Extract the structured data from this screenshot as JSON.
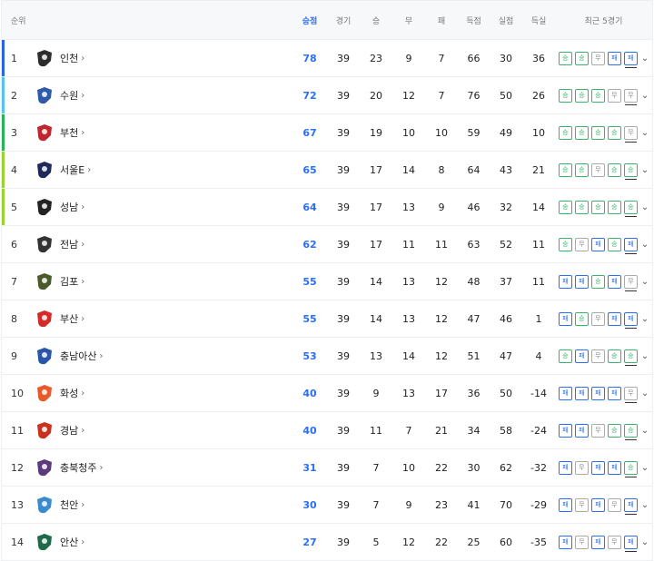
{
  "header": {
    "rank": "순위",
    "points": "승점",
    "played": "경기",
    "won": "승",
    "drawn": "무",
    "lost": "패",
    "gf": "득점",
    "ga": "실점",
    "gd": "득실",
    "form": "최근 5경기"
  },
  "colors": {
    "pts": "#2a6ff5",
    "win": "#3bb36c",
    "loss": "#2a6ff5",
    "draw": "#aaaaaa",
    "promo1": "#2c63f0",
    "promo2": "#55c4f0",
    "promo3": "#27b35a",
    "promo4": "#9cd233"
  },
  "teams": [
    {
      "rank": "1",
      "name": "인천",
      "pts": "78",
      "gp": "39",
      "w": "23",
      "d": "9",
      "l": "7",
      "gf": "66",
      "ga": "30",
      "gd": "36",
      "bar": "#2c63f0",
      "logo": "#2d2d2d",
      "form": [
        "승",
        "승",
        "무",
        "패",
        "패"
      ],
      "formKey": [
        "win",
        "win",
        "draw",
        "loss",
        "loss"
      ]
    },
    {
      "rank": "2",
      "name": "수원",
      "pts": "72",
      "gp": "39",
      "w": "20",
      "d": "12",
      "l": "7",
      "gf": "76",
      "ga": "50",
      "gd": "26",
      "bar": "#55c4f0",
      "logo": "#2e5aa8",
      "form": [
        "승",
        "승",
        "승",
        "무",
        "무"
      ],
      "formKey": [
        "win",
        "win",
        "win",
        "draw",
        "draw"
      ]
    },
    {
      "rank": "3",
      "name": "부천",
      "pts": "67",
      "gp": "39",
      "w": "19",
      "d": "10",
      "l": "10",
      "gf": "59",
      "ga": "49",
      "gd": "10",
      "bar": "#27b35a",
      "logo": "#c0262e",
      "form": [
        "승",
        "승",
        "승",
        "승",
        "무"
      ],
      "formKey": [
        "win",
        "win",
        "win",
        "win",
        "draw"
      ]
    },
    {
      "rank": "4",
      "name": "서울E",
      "pts": "65",
      "gp": "39",
      "w": "17",
      "d": "14",
      "l": "8",
      "gf": "64",
      "ga": "43",
      "gd": "21",
      "bar": "#9cd233",
      "logo": "#1e2a5a",
      "form": [
        "승",
        "승",
        "무",
        "승",
        "승"
      ],
      "formKey": [
        "win",
        "win",
        "draw",
        "win",
        "win"
      ]
    },
    {
      "rank": "5",
      "name": "성남",
      "pts": "64",
      "gp": "39",
      "w": "17",
      "d": "13",
      "l": "9",
      "gf": "46",
      "ga": "32",
      "gd": "14",
      "bar": "#9cd233",
      "logo": "#222222",
      "form": [
        "승",
        "승",
        "승",
        "승",
        "승"
      ],
      "formKey": [
        "win",
        "win",
        "win",
        "win",
        "win"
      ]
    },
    {
      "rank": "6",
      "name": "전남",
      "pts": "62",
      "gp": "39",
      "w": "17",
      "d": "11",
      "l": "11",
      "gf": "63",
      "ga": "52",
      "gd": "11",
      "bar": "",
      "logo": "#333333",
      "form": [
        "승",
        "무",
        "패",
        "승",
        "패"
      ],
      "formKey": [
        "win",
        "draw",
        "loss",
        "win",
        "loss"
      ]
    },
    {
      "rank": "7",
      "name": "김포",
      "pts": "55",
      "gp": "39",
      "w": "14",
      "d": "13",
      "l": "12",
      "gf": "48",
      "ga": "37",
      "gd": "11",
      "bar": "",
      "logo": "#4a5a2a",
      "form": [
        "패",
        "패",
        "승",
        "패",
        "무"
      ],
      "formKey": [
        "loss",
        "loss",
        "win",
        "loss",
        "draw"
      ]
    },
    {
      "rank": "8",
      "name": "부산",
      "pts": "55",
      "gp": "39",
      "w": "14",
      "d": "13",
      "l": "12",
      "gf": "47",
      "ga": "46",
      "gd": "1",
      "bar": "",
      "logo": "#d42a2a",
      "form": [
        "패",
        "승",
        "무",
        "패",
        "패"
      ],
      "formKey": [
        "loss",
        "win",
        "draw",
        "loss",
        "loss"
      ]
    },
    {
      "rank": "9",
      "name": "충남아산",
      "pts": "53",
      "gp": "39",
      "w": "13",
      "d": "14",
      "l": "12",
      "gf": "51",
      "ga": "47",
      "gd": "4",
      "bar": "",
      "logo": "#2a55a8",
      "form": [
        "승",
        "패",
        "무",
        "승",
        "승"
      ],
      "formKey": [
        "win",
        "loss",
        "draw",
        "win",
        "win"
      ]
    },
    {
      "rank": "10",
      "name": "화성",
      "pts": "40",
      "gp": "39",
      "w": "9",
      "d": "13",
      "l": "17",
      "gf": "36",
      "ga": "50",
      "gd": "-14",
      "bar": "",
      "logo": "#e85a2a",
      "form": [
        "패",
        "패",
        "패",
        "패",
        "무"
      ],
      "formKey": [
        "loss",
        "loss",
        "loss",
        "loss",
        "draw"
      ]
    },
    {
      "rank": "11",
      "name": "경남",
      "pts": "40",
      "gp": "39",
      "w": "11",
      "d": "7",
      "l": "21",
      "gf": "34",
      "ga": "58",
      "gd": "-24",
      "bar": "",
      "logo": "#c8321e",
      "form": [
        "패",
        "패",
        "무",
        "승",
        "승"
      ],
      "formKey": [
        "loss",
        "loss",
        "draw",
        "win",
        "win"
      ]
    },
    {
      "rank": "12",
      "name": "충북청주",
      "pts": "31",
      "gp": "39",
      "w": "7",
      "d": "10",
      "l": "22",
      "gf": "30",
      "ga": "62",
      "gd": "-32",
      "bar": "",
      "logo": "#5a3a7a",
      "form": [
        "패",
        "무",
        "패",
        "패",
        "승"
      ],
      "formKey": [
        "loss",
        "draw",
        "loss",
        "loss",
        "win"
      ]
    },
    {
      "rank": "13",
      "name": "천안",
      "pts": "30",
      "gp": "39",
      "w": "7",
      "d": "9",
      "l": "23",
      "gf": "41",
      "ga": "70",
      "gd": "-29",
      "bar": "",
      "logo": "#3a8ad0",
      "form": [
        "패",
        "무",
        "패",
        "무",
        "패"
      ],
      "formKey": [
        "loss",
        "draw",
        "loss",
        "draw",
        "loss"
      ]
    },
    {
      "rank": "14",
      "name": "안산",
      "pts": "27",
      "gp": "39",
      "w": "5",
      "d": "12",
      "l": "22",
      "gf": "25",
      "ga": "60",
      "gd": "-35",
      "bar": "",
      "logo": "#1e6a4a",
      "form": [
        "패",
        "무",
        "패",
        "무",
        "패"
      ],
      "formKey": [
        "loss",
        "draw",
        "loss",
        "draw",
        "loss"
      ]
    }
  ]
}
